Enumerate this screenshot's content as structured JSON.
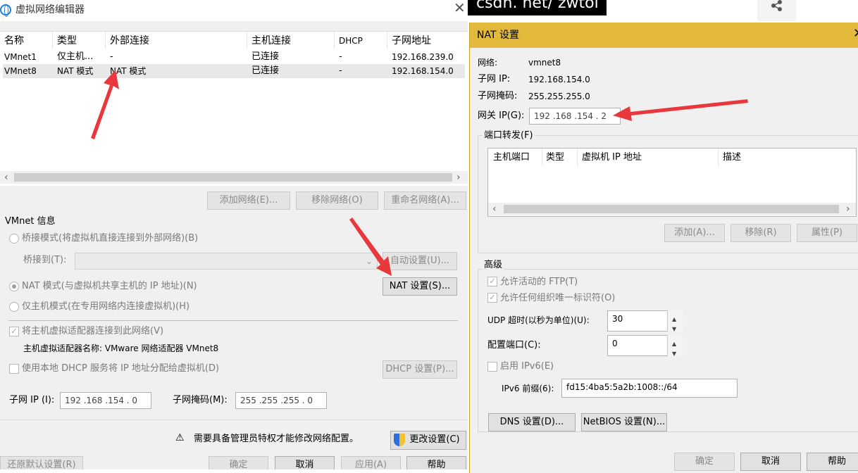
{
  "left_window": {
    "title": "虚拟网络编辑器",
    "columns": [
      "名称",
      "类型",
      "外部连接",
      "主机连接",
      "DHCP",
      "子网地址"
    ],
    "rows": [
      {
        "name": "VMnet1",
        "type": "仅主机...",
        "external": "-",
        "host": "已连接",
        "dhcp": "-",
        "subnet": "192.168.239.0"
      },
      {
        "name": "VMnet8",
        "type": "NAT 模式",
        "external": "NAT 模式",
        "host": "已连接",
        "dhcp": "-",
        "subnet": "192.168.154.0"
      }
    ],
    "buttons": {
      "add_network": "添加网络(E)...",
      "remove_network": "移除网络(O)",
      "rename_network": "重命名网络(A)..."
    },
    "vmnet_info": {
      "heading": "VMnet 信息",
      "bridged": "桥接模式(将虚拟机直接连接到外部网络)(B)",
      "bridge_to": "桥接到(T):",
      "auto_settings": "自动设置(U)...",
      "nat_mode": "NAT 模式(与虚拟机共享主机的 IP 地址)(N)",
      "nat_settings": "NAT 设置(S)...",
      "host_only": "仅主机模式(在专用网络内连接虚拟机)(H)",
      "connect_adapter": "将主机虚拟适配器连接到此网络(V)",
      "adapter_name": "主机虚拟适配器名称: VMware 网络适配器 VMnet8",
      "use_dhcp": "使用本地 DHCP 服务将 IP 地址分配给虚拟机(D)",
      "dhcp_settings": "DHCP 设置(P)...",
      "subnet_ip_label": "子网 IP (I):",
      "subnet_ip": "192 .168 .154 .  0",
      "subnet_mask_label": "子网掩码(M):",
      "subnet_mask": "255 .255 .255 .  0"
    },
    "admin_notice": "需要具备管理员特权才能修改网络配置。",
    "change_settings": "更改设置(C)",
    "restore_defaults": "还原默认设置(R)",
    "ok": "确定",
    "cancel": "取消",
    "apply": "应用(A)",
    "help": "帮助"
  },
  "background": {
    "blog_text": "csdn. net/ zwtol"
  },
  "nat_dialog": {
    "title": "NAT 设置",
    "network_label": "网络:",
    "network_value": "vmnet8",
    "subnet_ip_label": "子网 IP:",
    "subnet_ip_value": "192.168.154.0",
    "subnet_mask_label": "子网掩码:",
    "subnet_mask_value": "255.255.255.0",
    "gateway_label": "网关 IP(G):",
    "gateway_value": "192 .168 .154 .  2",
    "port_forwarding": "端口转发(F)",
    "pf_columns": [
      "主机端口",
      "类型",
      "虚拟机 IP 地址",
      "描述"
    ],
    "add": "添加(A)...",
    "remove": "移除(R)",
    "properties": "属性(P)",
    "advanced": "高级",
    "allow_ftp": "允许活动的 FTP(T)",
    "allow_any_oui": "允许任何组织唯一标识符(O)",
    "udp_timeout_label": "UDP 超时(以秒为单位)(U):",
    "udp_timeout_value": "30",
    "config_port_label": "配置端口(C):",
    "config_port_value": "0",
    "enable_ipv6": "启用 IPv6(E)",
    "ipv6_prefix_label": "IPv6 前缀(6):",
    "ipv6_prefix_value": "fd15:4ba5:5a2b:1008::/64",
    "dns_settings": "DNS 设置(D)...",
    "netbios_settings": "NetBIOS 设置(N)...",
    "ok": "确定",
    "cancel": "取消",
    "help": "帮助"
  },
  "colors": {
    "nat_titlebar": "#e2b93b",
    "arrow": "#e8383d",
    "focus": "#0078d7"
  }
}
